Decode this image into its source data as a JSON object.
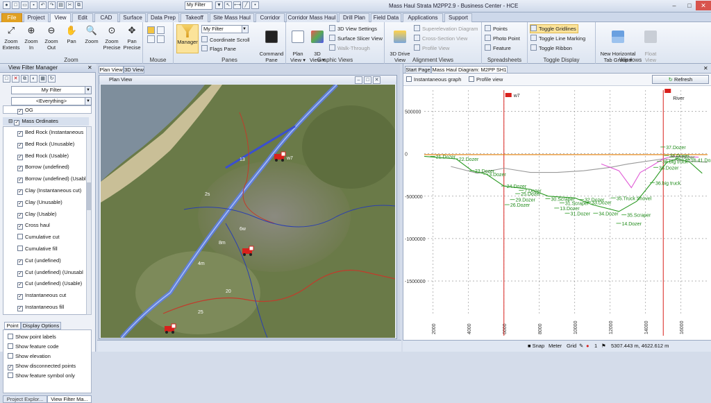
{
  "app": {
    "title": "Mass Haul Strata M2PP2.9 - Business Center - HCE",
    "quick_filter": "My Filter",
    "window_buttons": [
      "–",
      "□",
      "✕"
    ]
  },
  "tabs": [
    "File",
    "Project",
    "View",
    "Edit",
    "CAD",
    "Surface",
    "Data Prep",
    "Takeoff",
    "Site Mass Haul",
    "Corridor",
    "Corridor Mass Haul",
    "Drill Plan",
    "Field Data",
    "Applications",
    "Support"
  ],
  "active_tab": "View",
  "ribbon": {
    "zoom": {
      "label": "Zoom",
      "buttons": [
        "Zoom\nExtents",
        "Zoom\nIn",
        "Zoom\nOut",
        "Pan",
        "Zoom",
        "Zoom\nPrecise",
        "Pan\nPrecise"
      ]
    },
    "mouse": {
      "label": "Mouse"
    },
    "panes": {
      "label": "Panes",
      "manager": "Manager",
      "filter": "My Filter",
      "coord": "Coordinate Scroll",
      "flags": "Flags Pane",
      "command": "Command\nPane"
    },
    "graphic": {
      "label": "Graphic Views",
      "plan": "Plan\nView ▾",
      "view3d": "3D\nView ▾",
      "settings": "3D View Settings",
      "slicer": "Surface Slicer View",
      "walk": "Walk-Through"
    },
    "alignment": {
      "label": "Alignment Views",
      "drive": "3D Drive\nView",
      "super": "Superelevation Diagram",
      "cross": "Cross-Section View",
      "profile": "Profile View"
    },
    "spreadsheets": {
      "label": "Spreadsheets",
      "points": "Points",
      "photo": "Photo Point",
      "feature": "Feature"
    },
    "toggle": {
      "label": "Toggle Display",
      "grid": "Toggle Gridlines",
      "line": "Toggle Line Marking",
      "ribbon": "Toggle Ribbon"
    },
    "windows": {
      "label": "Windows",
      "tab": "New Horizontal\nTab Group ▾",
      "float": "Float\nView"
    }
  },
  "left": {
    "title": "View Filter Manager",
    "filter": "My Filter",
    "everything": "<Everything>",
    "og": "OG",
    "group": "Mass Ordinates",
    "layers": [
      {
        "label": "Bed Rock (Instantaneous",
        "checked": true
      },
      {
        "label": "Bed Rock (Unusable)",
        "checked": true
      },
      {
        "label": "Bed Rock (Usable)",
        "checked": true
      },
      {
        "label": "Borrow (undefined)",
        "checked": true
      },
      {
        "label": "Borrow (undefined) (Usabl",
        "checked": true
      },
      {
        "label": "Clay (Instantaneous cut)",
        "checked": true
      },
      {
        "label": "Clay (Unusable)",
        "checked": true
      },
      {
        "label": "Clay (Usable)",
        "checked": true
      },
      {
        "label": "Cross haul",
        "checked": true
      },
      {
        "label": "Cumulative cut",
        "checked": false
      },
      {
        "label": "Cumulative fill",
        "checked": false
      },
      {
        "label": "Cut (undefined)",
        "checked": true
      },
      {
        "label": "Cut (undefined) (Unusabl",
        "checked": true
      },
      {
        "label": "Cut (undefined) (Usable)",
        "checked": true
      },
      {
        "label": "Instantaneous cut",
        "checked": true
      },
      {
        "label": "Instantaneous fill",
        "checked": true
      }
    ],
    "tabs": [
      "Point",
      "Display Options"
    ],
    "options": [
      {
        "label": "Show point labels",
        "checked": false
      },
      {
        "label": "Show feature code",
        "checked": false
      },
      {
        "label": "Show elevation",
        "checked": false
      },
      {
        "label": "Show disconnected points",
        "checked": true
      },
      {
        "label": "Show feature symbol only",
        "checked": false
      }
    ],
    "bottom_tabs": [
      "Project Explor...",
      "View Filter Ma..."
    ]
  },
  "map": {
    "tabs": [
      "Plan View",
      "3D View"
    ],
    "title": "Plan View",
    "labels": [
      "w7",
      "6w",
      "2s",
      "20",
      "25",
      "4m",
      "8m",
      "13"
    ]
  },
  "right": {
    "tabs": [
      "Start Page",
      "Mass Haul Diagram: M2PP SH1"
    ],
    "instantaneous": "Instantaneous graph",
    "profile": "Profile view",
    "refresh": "Refresh",
    "flags": [
      "w7",
      "River"
    ]
  },
  "chart_data": {
    "type": "line",
    "ylim": [
      -1900000,
      750000
    ],
    "xlim": [
      1500,
      17500
    ],
    "yticks": [
      500000,
      0,
      -500000,
      -1000000,
      -1500000
    ],
    "ytick_labels": [
      "500000",
      "0",
      "-500000",
      "-1000000",
      "-1500000"
    ],
    "xticks": [
      2000,
      4000,
      6000,
      8000,
      10000,
      12000,
      14000,
      16000
    ],
    "xtick_labels": [
      "2000",
      "4000",
      "6000",
      "8000",
      "10000",
      "12000",
      "14000",
      "16000"
    ],
    "markers": [
      6000,
      15000
    ],
    "series": [
      {
        "color": "#e07a00",
        "values": [
          [
            1500,
            -10000
          ],
          [
            17500,
            -10000
          ]
        ]
      },
      {
        "color": "#999999",
        "values": [
          [
            3000,
            -150000
          ],
          [
            4500,
            -230000
          ],
          [
            6000,
            -170000
          ],
          [
            7500,
            -220000
          ],
          [
            9000,
            -220000
          ],
          [
            10500,
            -200000
          ],
          [
            12000,
            -160000
          ],
          [
            13000,
            -120000
          ],
          [
            14000,
            -90000
          ],
          [
            15000,
            -60000
          ],
          [
            16000,
            -80000
          ],
          [
            17500,
            -100000
          ]
        ]
      },
      {
        "color": "#e05bd6",
        "values": [
          [
            11500,
            -120000
          ],
          [
            12500,
            -200000
          ],
          [
            13200,
            -400000
          ],
          [
            13700,
            -220000
          ],
          [
            14300,
            -150000
          ],
          [
            15000,
            -60000
          ],
          [
            15500,
            -30000
          ],
          [
            17000,
            -40000
          ]
        ]
      },
      {
        "color": "#2a9a22",
        "values": [
          [
            1500,
            -30000
          ],
          [
            3300,
            -60000
          ],
          [
            4200,
            -200000
          ],
          [
            5000,
            -240000
          ],
          [
            6000,
            -380000
          ],
          [
            7500,
            -420000
          ],
          [
            8500,
            -500000
          ],
          [
            10000,
            -520000
          ],
          [
            11000,
            -600000
          ],
          [
            12500,
            -680000
          ],
          [
            13500,
            -560000
          ],
          [
            14500,
            -300000
          ],
          [
            15200,
            -100000
          ],
          [
            15800,
            -60000
          ],
          [
            16500,
            -100000
          ],
          [
            17200,
            -230000
          ]
        ]
      }
    ],
    "annotations": [
      {
        "x": 2000,
        "y": -30000,
        "text": "21.Dozer"
      },
      {
        "x": 3300,
        "y": -60000,
        "text": "22.Dozer"
      },
      {
        "x": 4200,
        "y": -200000,
        "text": "23.Dozer"
      },
      {
        "x": 5000,
        "y": -240000,
        "text": "3.Dozer"
      },
      {
        "x": 6000,
        "y": -380000,
        "text": "24.Dozer"
      },
      {
        "x": 7000,
        "y": -430000,
        "text": "7.Dozer"
      },
      {
        "x": 6800,
        "y": -470000,
        "text": "25.Dozer"
      },
      {
        "x": 6500,
        "y": -540000,
        "text": "29.Dozer"
      },
      {
        "x": 6200,
        "y": -600000,
        "text": "26.Dozer"
      },
      {
        "x": 8500,
        "y": -530000,
        "text": "30.Scraper"
      },
      {
        "x": 9300,
        "y": -580000,
        "text": "31.Scraper"
      },
      {
        "x": 9000,
        "y": -640000,
        "text": "13.Dozer"
      },
      {
        "x": 9600,
        "y": -700000,
        "text": "31.Dozer"
      },
      {
        "x": 10400,
        "y": -540000,
        "text": "32.Dozer"
      },
      {
        "x": 10800,
        "y": -570000,
        "text": "33.Dozer"
      },
      {
        "x": 11200,
        "y": -700000,
        "text": "34.Dozer"
      },
      {
        "x": 12200,
        "y": -520000,
        "text": "35.Truck Shovel"
      },
      {
        "x": 12800,
        "y": -720000,
        "text": "35.Scraper"
      },
      {
        "x": 12500,
        "y": -820000,
        "text": "14.Dozer"
      },
      {
        "x": 15000,
        "y": 80000,
        "text": "37.Dozer"
      },
      {
        "x": 15200,
        "y": -20000,
        "text": "38.Dozer"
      },
      {
        "x": 15500,
        "y": -40000,
        "text": "40.Dozer"
      },
      {
        "x": 14800,
        "y": -90000,
        "text": "36.big truck"
      },
      {
        "x": 14600,
        "y": -160000,
        "text": "36.Dozer"
      },
      {
        "x": 14400,
        "y": -340000,
        "text": "36.big truck"
      },
      {
        "x": 16400,
        "y": -70000,
        "text": "16.41.Dozer"
      }
    ]
  },
  "status": {
    "snap": "Snap",
    "meter": "Meter",
    "grid": "Grid",
    "num": "1",
    "coords": "5307.443 m, 4622.612 m"
  }
}
